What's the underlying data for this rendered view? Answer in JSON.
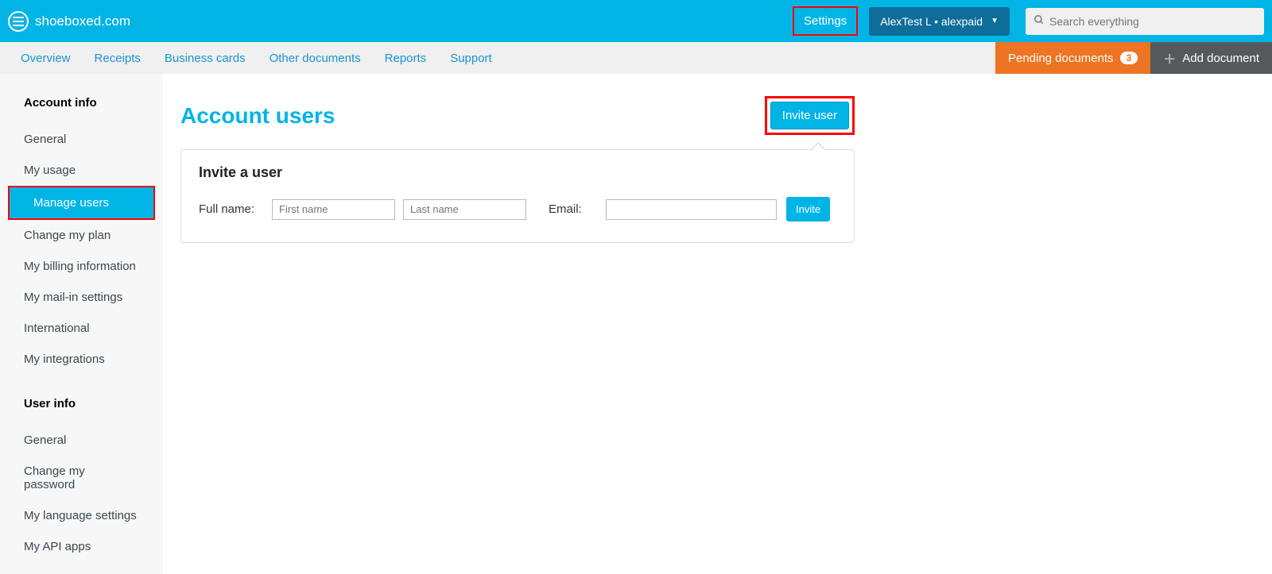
{
  "brand": "shoeboxed.com",
  "header": {
    "settings_label": "Settings",
    "user_label": "AlexTest L • alexpaid",
    "search_placeholder": "Search everything"
  },
  "subnav": {
    "items": [
      "Overview",
      "Receipts",
      "Business cards",
      "Other documents",
      "Reports",
      "Support"
    ],
    "pending_label": "Pending documents",
    "pending_count": "3",
    "add_doc_label": "Add document"
  },
  "sidebar": {
    "section1_title": "Account info",
    "section1_items": [
      "General",
      "My usage",
      "Manage users",
      "Change my plan",
      "My billing information",
      "My mail-in settings",
      "International",
      "My integrations"
    ],
    "active_index": 2,
    "section2_title": "User info",
    "section2_items": [
      "General",
      "Change my password",
      "My language settings",
      "My API apps"
    ]
  },
  "main": {
    "page_title": "Account users",
    "invite_user_btn": "Invite user",
    "card_title": "Invite a user",
    "full_name_label": "Full name:",
    "first_name_placeholder": "First name",
    "last_name_placeholder": "Last name",
    "email_label": "Email:",
    "invite_btn": "Invite"
  }
}
